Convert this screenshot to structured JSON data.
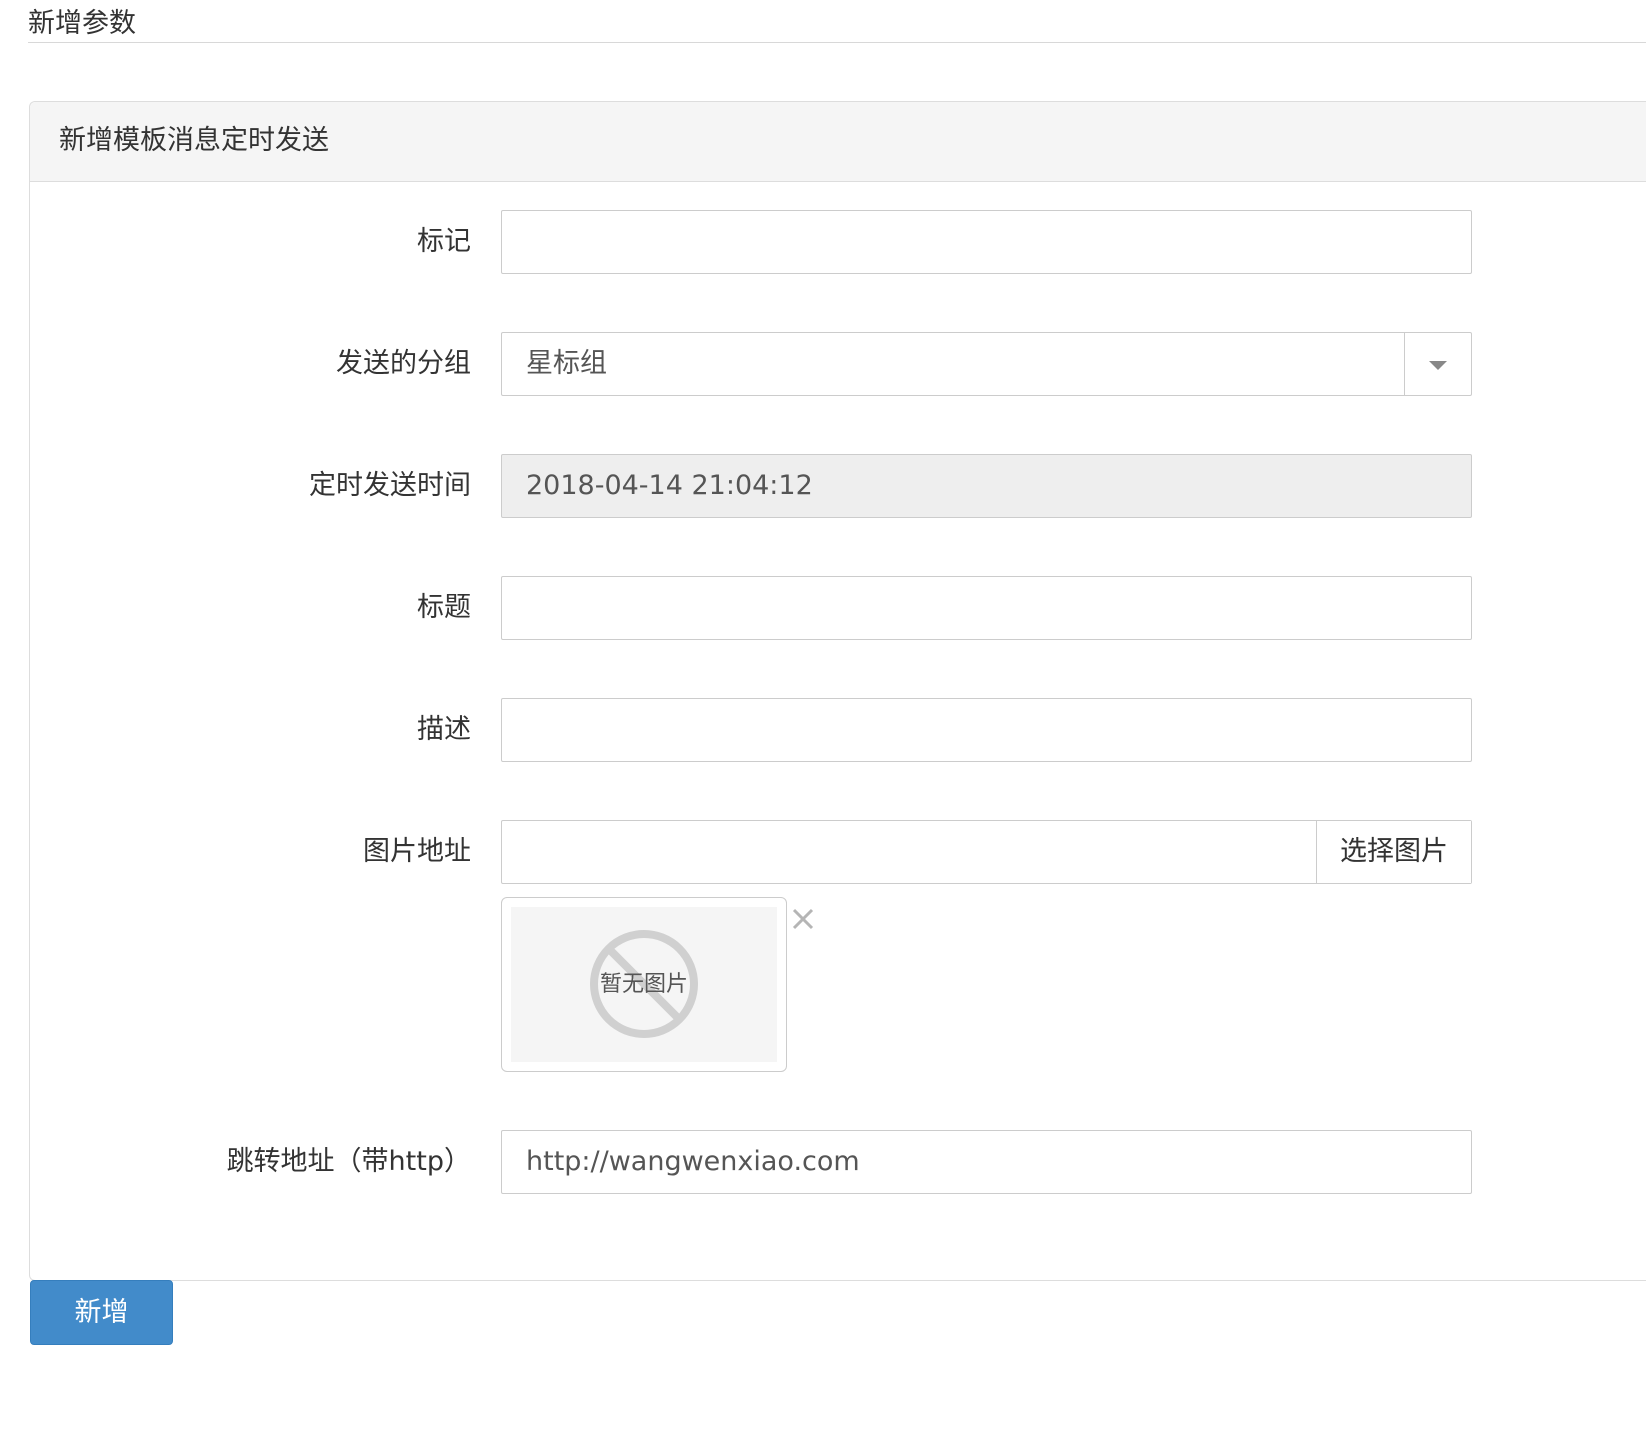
{
  "page": {
    "title": "新增参数"
  },
  "panel": {
    "heading": "新增模板消息定时发送"
  },
  "form": {
    "tag": {
      "label": "标记",
      "value": ""
    },
    "group": {
      "label": "发送的分组",
      "selected": "星标组"
    },
    "send_time": {
      "label": "定时发送时间",
      "value": "2018-04-14 21:04:12"
    },
    "title_field": {
      "label": "标题",
      "value": ""
    },
    "description": {
      "label": "描述",
      "value": ""
    },
    "image_url": {
      "label": "图片地址",
      "value": "",
      "choose_button": "选择图片",
      "placeholder_image_text": "暂无图片"
    },
    "redirect_url": {
      "label": "跳转地址（带http）",
      "value": "http://wangwenxiao.com"
    }
  },
  "actions": {
    "submit_label": "新增"
  },
  "icons": {
    "select_caret": "chevron-down-icon",
    "remove_image": "close-icon",
    "no_image": "no-image-icon"
  },
  "colors": {
    "primary_button": "#428bca",
    "panel_heading_bg": "#f5f5f5",
    "disabled_input_bg": "#eeeeee"
  }
}
